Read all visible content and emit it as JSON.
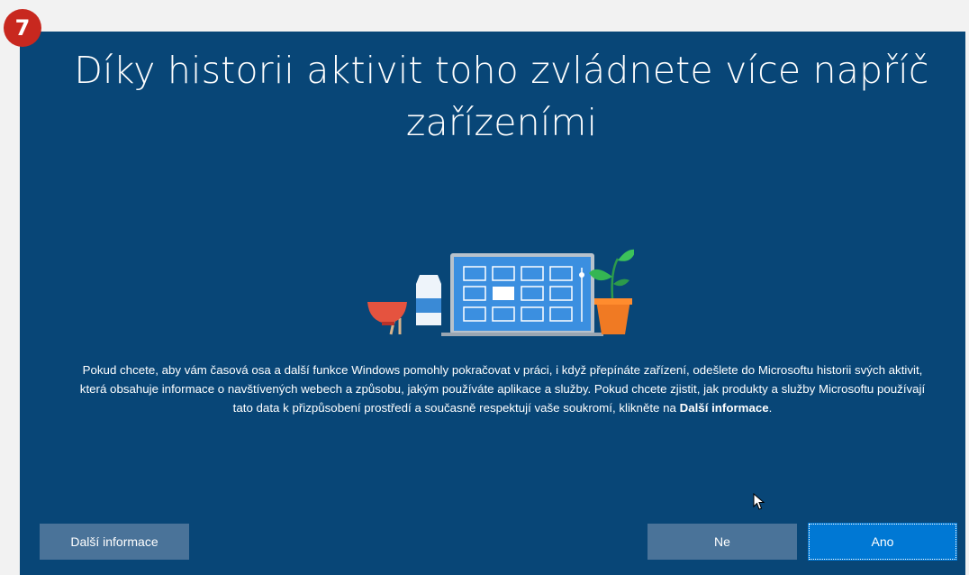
{
  "step_badge": "7",
  "title_line1": "Díky historii aktivit toho zvládnete více napříč",
  "title_line2": "zařízeními",
  "body": {
    "text_before": "Pokud chcete, aby vám časová osa a další funkce Windows pomohly pokračovat v práci, i když přepínáte zařízení, odešlete do Microsoftu historii svých aktivit, která obsahuje informace o navštívených webech a způsobu, jakým používáte aplikace a služby. Pokud chcete zjistit, jak produkty a služby Microsoftu používají tato data k přizpůsobení prostředí a současně respektují vaše soukromí, klikněte na ",
    "link_text": "Další informace",
    "text_after": "."
  },
  "buttons": {
    "more_info": "Další informace",
    "no": "Ne",
    "yes": "Ano"
  },
  "colors": {
    "background": "#084677",
    "button_secondary": "#4a7399",
    "button_primary": "#0078d4",
    "badge": "#c8281f"
  },
  "icons": {
    "illustration": "laptop-with-bowl-bottle-plant",
    "cursor": "mouse-pointer-icon"
  }
}
